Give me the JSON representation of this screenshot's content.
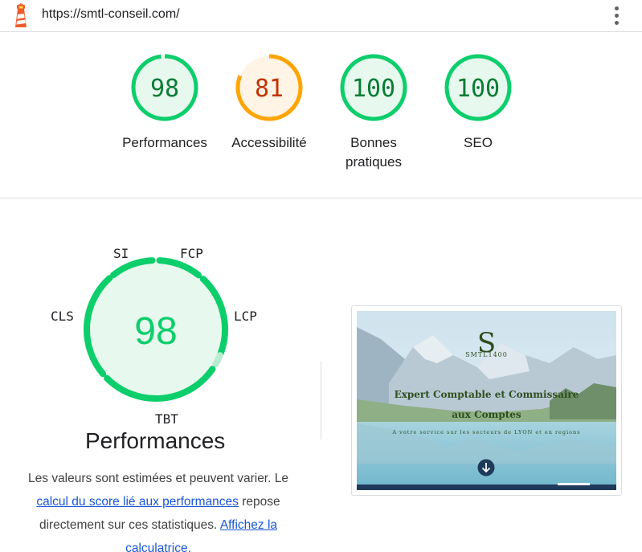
{
  "browser": {
    "url": "https://smtl-conseil.com/",
    "menu_icon": "more-vert-icon"
  },
  "colors": {
    "pass": "#0cce6b",
    "pass_text": "#0a7c34",
    "average": "#ffa400",
    "average_text": "#c33300",
    "pass_bg": "#e7f8ee",
    "average_bg": "#fff4e5"
  },
  "categories": [
    {
      "label": "Performances",
      "score": 98,
      "status": "pass"
    },
    {
      "label": "Accessibilité",
      "score": 81,
      "status": "average"
    },
    {
      "label": "Bonnes pratiques",
      "score": 100,
      "status": "pass"
    },
    {
      "label": "SEO",
      "score": 100,
      "status": "pass"
    }
  ],
  "performance": {
    "score": 98,
    "label": "Performances",
    "metrics": {
      "si": "SI",
      "fcp": "FCP",
      "lcp": "LCP",
      "tbt": "TBT",
      "cls": "CLS"
    }
  },
  "description": {
    "text_1": "Les valeurs sont estimées et peuvent varier. Le",
    "link_1": "calcul du score lié aux performances",
    "text_2": " repose directement sur ces statistiques. ",
    "link_2": "Affichez la calculatrice."
  },
  "screenshot": {
    "monogram": "S",
    "monogram_sub": "SMTL1400",
    "title_line1": "Expert Comptable et Commissaire",
    "title_line2": "aux Comptes",
    "tagline": "A votre service sur les secteurs de LYON et en regions",
    "scroll_icon": "arrow-down-icon"
  }
}
